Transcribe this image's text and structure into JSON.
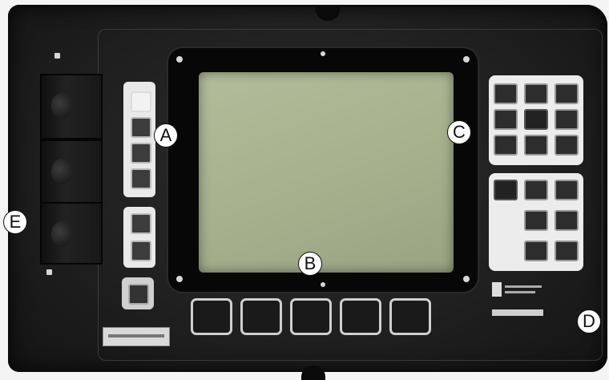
{
  "callouts": {
    "a": "A",
    "b": "B",
    "c": "C",
    "d": "D",
    "e": "E"
  },
  "colors": {
    "housing": "#202020",
    "screen": "#a6b08d",
    "keypad": "#ececec",
    "callout_bg": "#ffffff"
  },
  "icons": {
    "left_buttons": "square-button-icon",
    "keypad_keys": "key-icon",
    "screws": "screw-icon"
  }
}
